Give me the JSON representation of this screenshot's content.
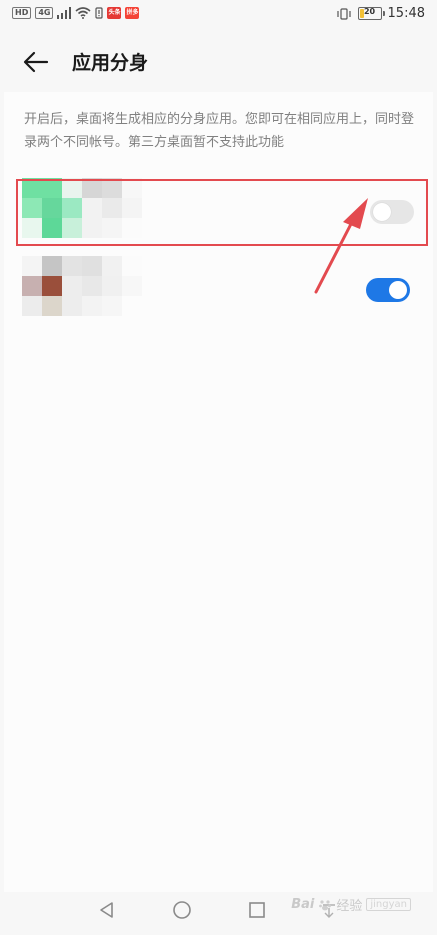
{
  "status_bar": {
    "left_tags": [
      "HD",
      "4G"
    ],
    "notifications": [
      {
        "label": "头条",
        "color": "#e53935"
      },
      {
        "label": "拼多",
        "color": "#f44336"
      }
    ],
    "battery_level": "20",
    "battery_percent": 20,
    "time": "15:48"
  },
  "app_bar": {
    "title": "应用分身"
  },
  "description": "开启后，桌面将生成相应的分身应用。您即可在相同应用上，同时登录两个不同帐号。第三方桌面暂不支持此功能",
  "apps": [
    {
      "toggle_on": false,
      "mosaic": [
        [
          "#6fe0a2",
          "#6fe0a2",
          "#e9f4ee",
          "#d6d6d6",
          "#dcdcdc",
          "#f7f7f7"
        ],
        [
          "#8de8b5",
          "#66d79c",
          "#9be9c2",
          "#f2f2f2",
          "#eaeaea",
          "#f4f4f4"
        ],
        [
          "#e8f7ee",
          "#5dd898",
          "#c8f0da",
          "#f2f2f2",
          "#f5f5f5",
          "#fbfbfb"
        ]
      ]
    },
    {
      "toggle_on": true,
      "mosaic": [
        [
          "#f4f4f4",
          "#c5c5c5",
          "#e3e3e3",
          "#e0e0e0",
          "#f1f1f1",
          "#fbfbfb"
        ],
        [
          "#c7b0b0",
          "#9a4f3b",
          "#ededed",
          "#e8e8e8",
          "#f0f0f0",
          "#f7f7f7"
        ],
        [
          "#ececec",
          "#dcd6cb",
          "#ededed",
          "#f3f3f3",
          "#f6f6f6",
          "#fcfcfc"
        ]
      ]
    }
  ],
  "colors": {
    "accent": "#1e78e6",
    "highlight": "#e34a4f"
  },
  "watermark": {
    "logo_text": "Bai",
    "label": "经验",
    "badge": "jingyan"
  }
}
